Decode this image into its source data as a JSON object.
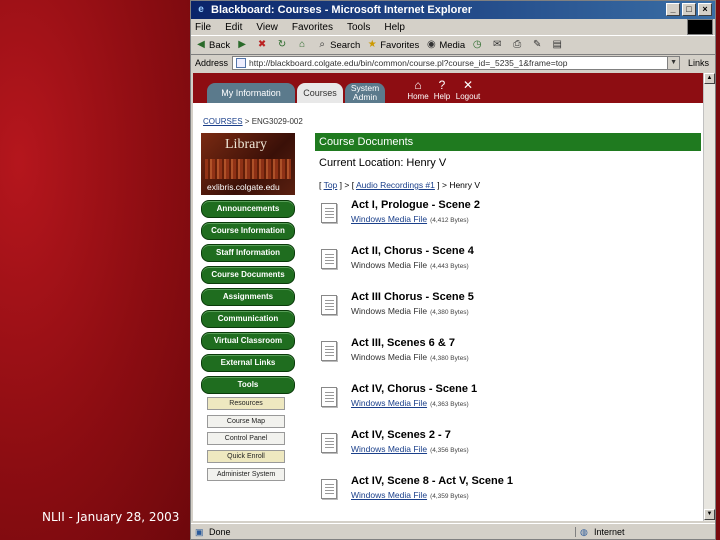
{
  "slide": {
    "footer": "NLII -  January 28, 2003"
  },
  "window": {
    "title": "Blackboard: Courses - Microsoft Internet Explorer",
    "controls": {
      "minimize": "_",
      "maximize": "□",
      "close": "×"
    }
  },
  "menu": {
    "items": [
      "File",
      "Edit",
      "View",
      "Favorites",
      "Tools",
      "Help"
    ]
  },
  "toolbar": {
    "back": "Back",
    "forward": "→",
    "search": "Search",
    "favorites": "Favorites",
    "media": "Media"
  },
  "address": {
    "label": "Address",
    "url": "http://blackboard.colgate.edu/bin/common/course.pl?course_id=_5235_1&frame=top",
    "links_label": "Links"
  },
  "blackboard": {
    "tabs": [
      "My Information",
      "Courses",
      "System Admin"
    ],
    "system_admin_lines": [
      "System",
      "Admin"
    ],
    "header_icons": [
      {
        "label": "Home",
        "glyph": "⌂"
      },
      {
        "label": "Help",
        "glyph": "?"
      },
      {
        "label": "Logout",
        "glyph": "✕"
      }
    ],
    "breadcrumb": {
      "link": "COURSES",
      "sep": " > ",
      "current": "ENG3029-002"
    },
    "library_banner": {
      "title": "Library",
      "subtitle": "exlibris.colgate.edu"
    },
    "nav": [
      "Announcements",
      "Course Information",
      "Staff Information",
      "Course Documents",
      "Assignments",
      "Communication",
      "Virtual Classroom",
      "External Links",
      "Tools"
    ],
    "tools": [
      "Resources",
      "Course Map",
      "Control Panel",
      "Quick Enroll",
      "Administer System"
    ]
  },
  "content": {
    "header": "Course Documents",
    "current_location": "Current Location: Henry V",
    "trail": {
      "top": "Top",
      "audio": "Audio Recordings #1",
      "current": "Henry V"
    },
    "items": [
      {
        "title": "Act I, Prologue - Scene 2",
        "file": "Windows Media File",
        "size": "(4,412 Bytes)",
        "linked": true
      },
      {
        "title": "Act II, Chorus - Scene 4",
        "file": "Windows Media File",
        "size": "(4,443 Bytes)",
        "linked": false
      },
      {
        "title": "Act III Chorus - Scene 5",
        "file": "Windows Media File",
        "size": "(4,380 Bytes)",
        "linked": false
      },
      {
        "title": "Act III, Scenes 6 & 7",
        "file": "Windows Media File",
        "size": "(4,380 Bytes)",
        "linked": false
      },
      {
        "title": "Act IV, Chorus - Scene 1",
        "file": "Windows Media File",
        "size": "(4,363 Bytes)",
        "linked": true
      },
      {
        "title": "Act IV, Scenes 2 - 7",
        "file": "Windows Media File",
        "size": "(4,356 Bytes)",
        "linked": true
      },
      {
        "title": "Act IV, Scene 8 - Act V, Scene 1",
        "file": "Windows Media File",
        "size": "(4,359 Bytes)",
        "linked": true
      }
    ]
  },
  "status": {
    "left": "Done",
    "zone": "Internet"
  },
  "colors": {
    "accent_green": "#1f7a1f",
    "blackboard_red": "#8d0d12",
    "slide_red": "#8d0d12",
    "link_blue": "#1a3f8a"
  }
}
